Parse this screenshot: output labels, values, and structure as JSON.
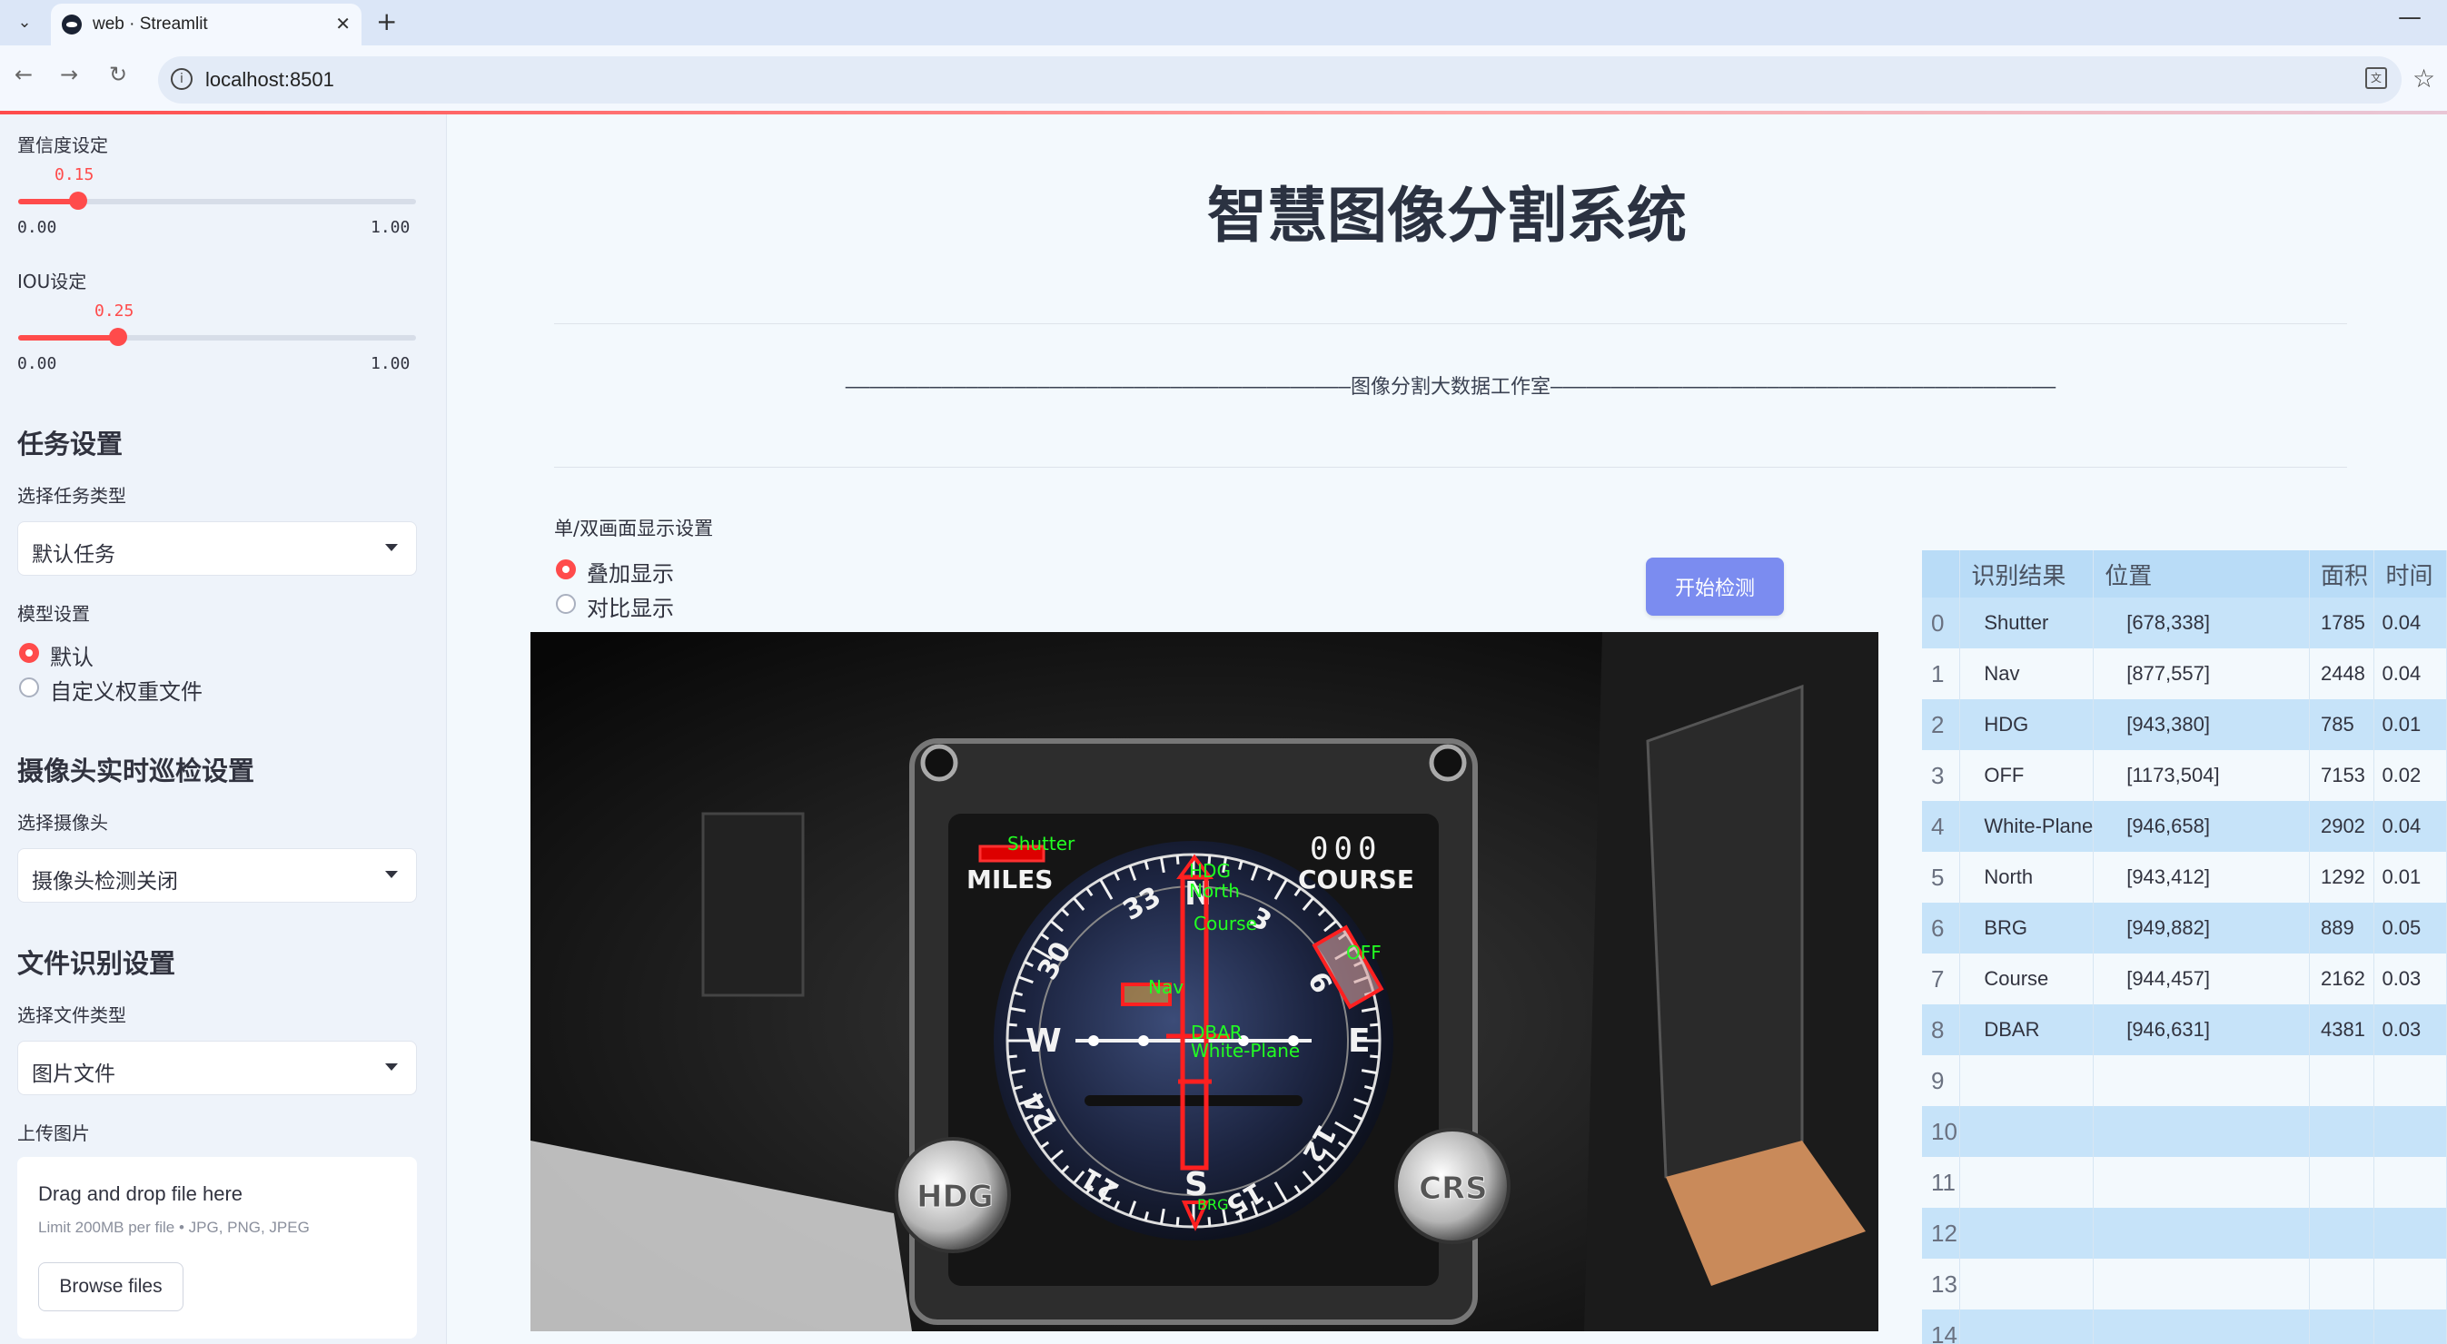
{
  "browser": {
    "tab_title": "web · Streamlit",
    "url": "localhost:8501"
  },
  "sidebar": {
    "confidence": {
      "label": "置信度设定",
      "value": "0.15",
      "value_num": 0.15,
      "min": "0.00",
      "max": "1.00"
    },
    "iou": {
      "label": "IOU设定",
      "value": "0.25",
      "value_num": 0.25,
      "min": "0.00",
      "max": "1.00"
    },
    "task_heading": "任务设置",
    "task_type_label": "选择任务类型",
    "task_type_value": "默认任务",
    "model_label": "模型设置",
    "model_options": [
      "默认",
      "自定义权重文件"
    ],
    "camera_heading": "摄像头实时巡检设置",
    "camera_label": "选择摄像头",
    "camera_value": "摄像头检测关闭",
    "file_heading": "文件识别设置",
    "file_type_label": "选择文件类型",
    "file_type_value": "图片文件",
    "upload_label": "上传图片",
    "upload_drop": "Drag and drop file here",
    "upload_limit": "Limit 200MB per file • JPG, PNG, JPEG",
    "upload_button": "Browse files"
  },
  "main": {
    "title": "智慧图像分割系统",
    "studio_banner": "——————————————————————————————————————————图像分割大数据工作室——————————————————————————————————————————",
    "display_label": "单/双画面显示设置",
    "display_options": [
      "叠加显示",
      "对比显示"
    ],
    "detect_button": "开始检测"
  },
  "detections_image": {
    "labels": [
      "Shutter",
      "Nav",
      "HDG",
      "North",
      "Course",
      "OFF",
      "DBAR",
      "White-Plane",
      "BRG"
    ],
    "dial_text": {
      "miles": "MILES",
      "course": "COURSE",
      "counter": "000",
      "knob_left": "HDG",
      "knob_right": "CRS"
    }
  },
  "results": {
    "columns": [
      "",
      "识别结果",
      "位置",
      "面积",
      "时间"
    ],
    "rows": [
      {
        "idx": "0",
        "name": "Shutter",
        "pos": "[678,338]",
        "area": "1785",
        "time": "0.04"
      },
      {
        "idx": "1",
        "name": "Nav",
        "pos": "[877,557]",
        "area": "2448",
        "time": "0.04"
      },
      {
        "idx": "2",
        "name": "HDG",
        "pos": "[943,380]",
        "area": "785",
        "time": "0.01"
      },
      {
        "idx": "3",
        "name": "OFF",
        "pos": "[1173,504]",
        "area": "7153",
        "time": "0.02"
      },
      {
        "idx": "4",
        "name": "White-Plane",
        "pos": "[946,658]",
        "area": "2902",
        "time": "0.04"
      },
      {
        "idx": "5",
        "name": "North",
        "pos": "[943,412]",
        "area": "1292",
        "time": "0.01"
      },
      {
        "idx": "6",
        "name": "BRG",
        "pos": "[949,882]",
        "area": "889",
        "time": "0.05"
      },
      {
        "idx": "7",
        "name": "Course",
        "pos": "[944,457]",
        "area": "2162",
        "time": "0.03"
      },
      {
        "idx": "8",
        "name": "DBAR",
        "pos": "[946,631]",
        "area": "4381",
        "time": "0.03"
      },
      {
        "idx": "9",
        "name": "",
        "pos": "",
        "area": "",
        "time": ""
      },
      {
        "idx": "10",
        "name": "",
        "pos": "",
        "area": "",
        "time": ""
      },
      {
        "idx": "11",
        "name": "",
        "pos": "",
        "area": "",
        "time": ""
      },
      {
        "idx": "12",
        "name": "",
        "pos": "",
        "area": "",
        "time": ""
      },
      {
        "idx": "13",
        "name": "",
        "pos": "",
        "area": "",
        "time": ""
      },
      {
        "idx": "14",
        "name": "",
        "pos": "",
        "area": "",
        "time": ""
      }
    ]
  },
  "colors": {
    "accent": "#ff4b4b",
    "button": "#7b8cf0",
    "table_header": "#b9dcf7",
    "table_stripe": "#c6e3f9",
    "detection_box": "#ff2020",
    "detection_label": "#22ff22"
  }
}
